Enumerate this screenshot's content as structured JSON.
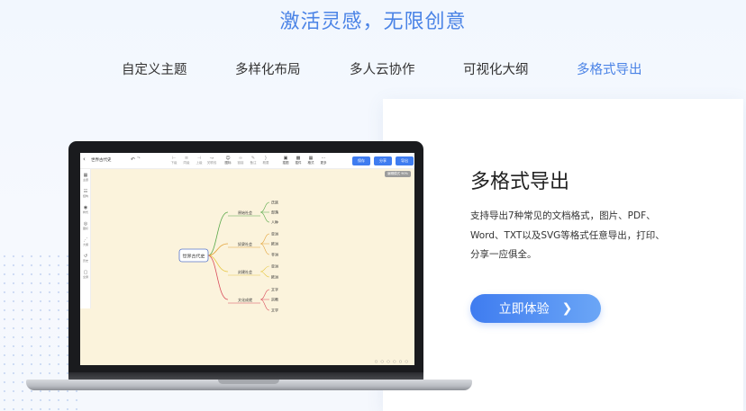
{
  "hero": {
    "title": "激活灵感，无限创意"
  },
  "tabs": [
    {
      "label": "自定义主题",
      "active": false
    },
    {
      "label": "多样化布局",
      "active": false
    },
    {
      "label": "多人云协作",
      "active": false
    },
    {
      "label": "可视化大纲",
      "active": false
    },
    {
      "label": "多格式导出",
      "active": true
    }
  ],
  "card": {
    "title": "多格式导出",
    "desc_lines": [
      "支持导出7种常见的文档格式，图片、PDF、",
      "Word、TXT以及SVG等格式任意导出，打印、",
      "分享一应俱全。"
    ],
    "cta_label": "立即体验",
    "cta_icon": "chevron-right-icon"
  },
  "colors": {
    "accent": "#4a83e6",
    "button": "#3f7cf0"
  },
  "app": {
    "doc_title": "世界古代史",
    "toolbar_tools": [
      {
        "label": "下级",
        "icon": "child-node-icon"
      },
      {
        "label": "同级",
        "icon": "sibling-node-icon"
      },
      {
        "label": "上级",
        "icon": "parent-node-icon"
      },
      {
        "label": "关联线",
        "icon": "link-icon"
      },
      {
        "label": "图标",
        "icon": "emoji-icon"
      },
      {
        "label": "链接",
        "icon": "hyperlink-icon"
      },
      {
        "label": "备注",
        "icon": "note-icon"
      },
      {
        "label": "概要",
        "icon": "summary-icon"
      },
      {
        "label": "插图",
        "icon": "image-icon"
      },
      {
        "label": "插件",
        "icon": "plugin-icon"
      },
      {
        "label": "格式",
        "icon": "format-icon"
      },
      {
        "label": "更多",
        "icon": "more-icon"
      }
    ],
    "buttons": [
      "保存",
      "分享",
      "导出"
    ],
    "sidebar": [
      {
        "label": "主题",
        "icon": "theme-icon"
      },
      {
        "label": "结构",
        "icon": "structure-icon"
      },
      {
        "label": "样式",
        "icon": "style-icon"
      },
      {
        "label": "图标",
        "icon": "icon-icon"
      },
      {
        "label": "大纲",
        "icon": "outline-icon"
      },
      {
        "label": "历史",
        "icon": "history-icon"
      },
      {
        "label": "全屏",
        "icon": "fullscreen-icon"
      }
    ],
    "badge": "编辑模式 90%",
    "mindmap": {
      "root": "世界古代史",
      "branches": [
        {
          "label": "原始社会",
          "color": "#5aa94a",
          "children": [
            "氏族",
            "部落",
            "人种"
          ]
        },
        {
          "label": "奴隶社会",
          "color": "#e3a33b",
          "children": [
            "亚洲",
            "欧洲",
            "非洲"
          ]
        },
        {
          "label": "封建社会",
          "color": "#e8c94a",
          "children": [
            "亚洲",
            "欧洲"
          ]
        },
        {
          "label": "文化成就",
          "color": "#d94a5a",
          "children": [
            "文字",
            "宗教",
            "文学"
          ]
        }
      ]
    }
  }
}
